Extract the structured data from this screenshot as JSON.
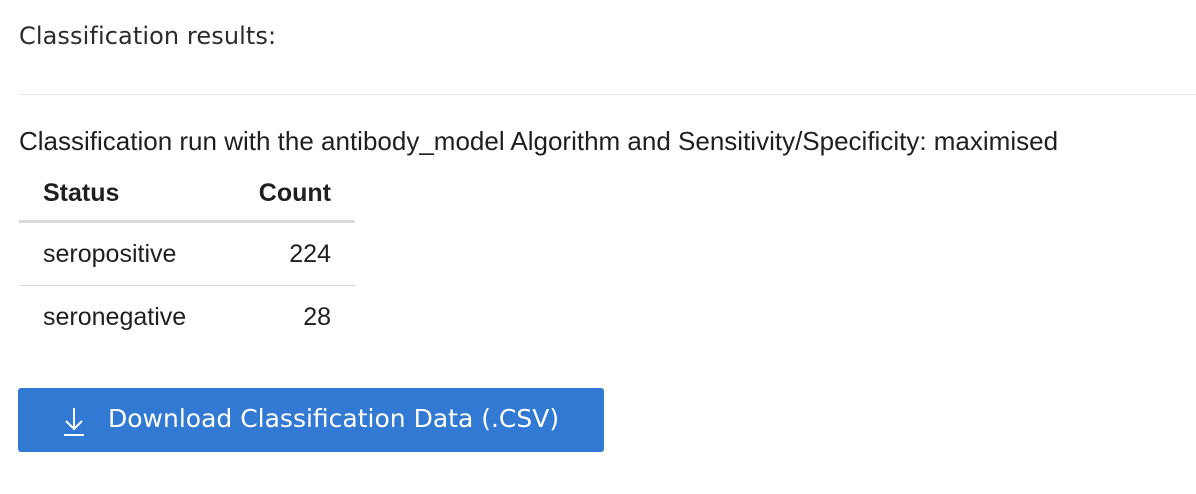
{
  "header": {
    "title": "Classification results:"
  },
  "run": {
    "description": "Classification run with the antibody_model Algorithm and Sensitivity/Specificity: maximised"
  },
  "table": {
    "columns": [
      "Status",
      "Count"
    ],
    "rows": [
      {
        "status": "seropositive",
        "count": "224"
      },
      {
        "status": "seronegative",
        "count": "28"
      }
    ]
  },
  "download": {
    "label": "Download Classification Data (.CSV)",
    "icon": "download-arrow-icon",
    "color": "#3179d3"
  }
}
